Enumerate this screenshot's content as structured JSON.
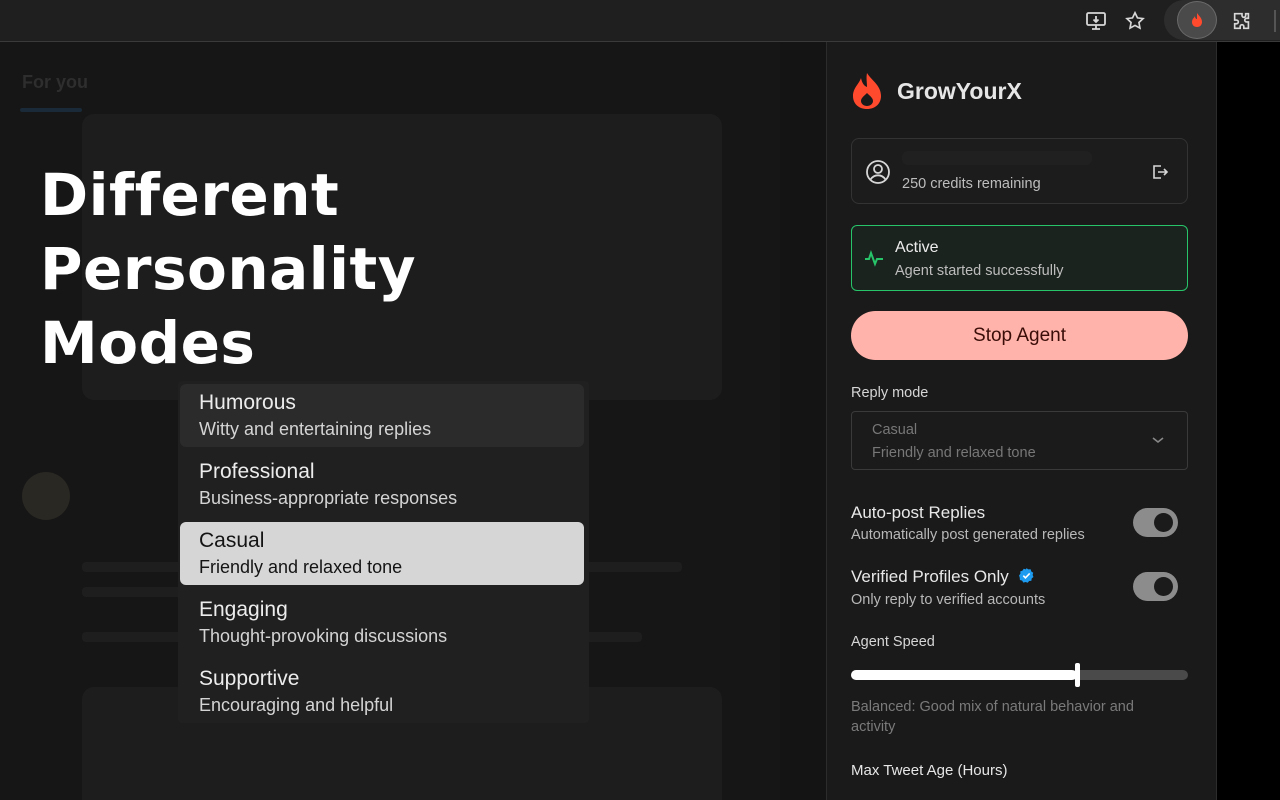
{
  "browser": {
    "icons": [
      "install-app-icon",
      "bookmark-star-icon",
      "growyourx-extension-icon",
      "extensions-puzzle-icon"
    ]
  },
  "promo": {
    "title_line1": "Different Personality",
    "title_line2": "Modes"
  },
  "background_page": {
    "tab_label": "For you"
  },
  "reply_mode_menu": {
    "items": [
      {
        "title": "Humorous",
        "description": "Witty and entertaining replies",
        "state": "hover"
      },
      {
        "title": "Professional",
        "description": "Business-appropriate responses",
        "state": "normal"
      },
      {
        "title": "Casual",
        "description": "Friendly and relaxed tone",
        "state": "selected"
      },
      {
        "title": "Engaging",
        "description": "Thought-provoking discussions",
        "state": "normal"
      },
      {
        "title": "Supportive",
        "description": "Encouraging and helpful",
        "state": "normal"
      }
    ]
  },
  "panel": {
    "brand": "GrowYourX",
    "account": {
      "credits_text": "250 credits remaining"
    },
    "status": {
      "title": "Active",
      "subtitle": "Agent started successfully",
      "color": "#27c46a"
    },
    "stop_button": "Stop Agent",
    "reply_mode": {
      "label": "Reply mode",
      "selected_title": "Casual",
      "selected_description": "Friendly and relaxed tone"
    },
    "auto_post": {
      "title": "Auto-post Replies",
      "description": "Automatically post generated replies",
      "enabled": true
    },
    "verified_only": {
      "title": "Verified Profiles Only",
      "description": "Only reply to verified accounts",
      "enabled": true
    },
    "agent_speed": {
      "label": "Agent Speed",
      "value_fraction": 0.67,
      "description": "Balanced: Good mix of natural behavior and activity"
    },
    "max_tweet_age_label": "Max Tweet Age (Hours)"
  },
  "colors": {
    "accent_red": "#ff4a2e",
    "stop_button_bg": "#ffb3aa",
    "verified_blue": "#1d9bf0"
  }
}
